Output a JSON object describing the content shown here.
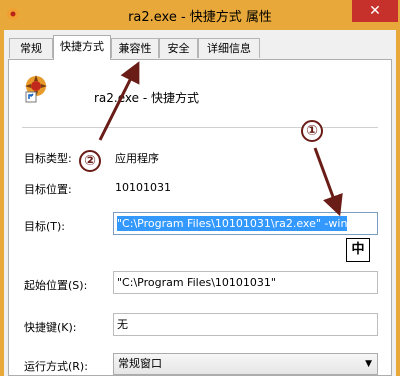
{
  "window": {
    "title": "ra2.exe - 快捷方式 属性",
    "close_glyph": "✕"
  },
  "tabs": [
    {
      "label": "常规"
    },
    {
      "label": "快捷方式"
    },
    {
      "label": "兼容性"
    },
    {
      "label": "安全"
    },
    {
      "label": "详细信息"
    }
  ],
  "shortcut": {
    "name": "ra2.exe - 快捷方式",
    "target_type_label": "目标类型:",
    "target_type_value": "应用程序",
    "target_location_label": "目标位置:",
    "target_location_value": "10101031",
    "target_label": "目标(T):",
    "target_value": "\"C:\\Program Files\\10101031\\ra2.exe\" -win",
    "start_in_label": "起始位置(S):",
    "start_in_value": "\"C:\\Program Files\\10101031\"",
    "hotkey_label": "快捷键(K):",
    "hotkey_value": "无",
    "run_label": "运行方式(R):",
    "run_value": "常规窗口"
  },
  "ime_indicator": "中",
  "annotations": {
    "one": "①",
    "two": "②",
    "color": "#6a1d16"
  }
}
